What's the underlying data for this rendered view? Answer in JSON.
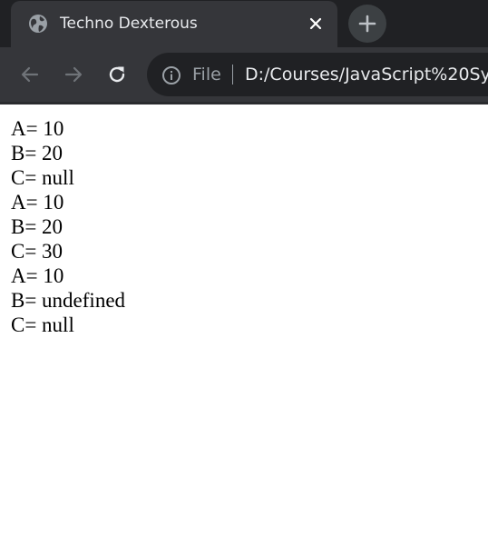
{
  "tab": {
    "title": "Techno Dexterous",
    "favicon": "globe-icon",
    "close_icon": "close-icon"
  },
  "new_tab_icon": "plus-icon",
  "toolbar": {
    "back_icon": "arrow-left-icon",
    "forward_icon": "arrow-right-icon",
    "reload_icon": "reload-icon",
    "info_icon": "info-icon",
    "scheme_label": "File",
    "url": "D:/Courses/JavaScript%20Syll"
  },
  "colors": {
    "tab_strip": "#202124",
    "active_tab": "#35363a",
    "toolbar": "#35363a",
    "omnibox": "#202124",
    "page": "#ffffff"
  },
  "output": [
    "A= 10",
    "B= 20",
    "C= null",
    "A= 10",
    "B= 20",
    "C= 30",
    "A= 10",
    "B= undefined",
    "C= null"
  ]
}
